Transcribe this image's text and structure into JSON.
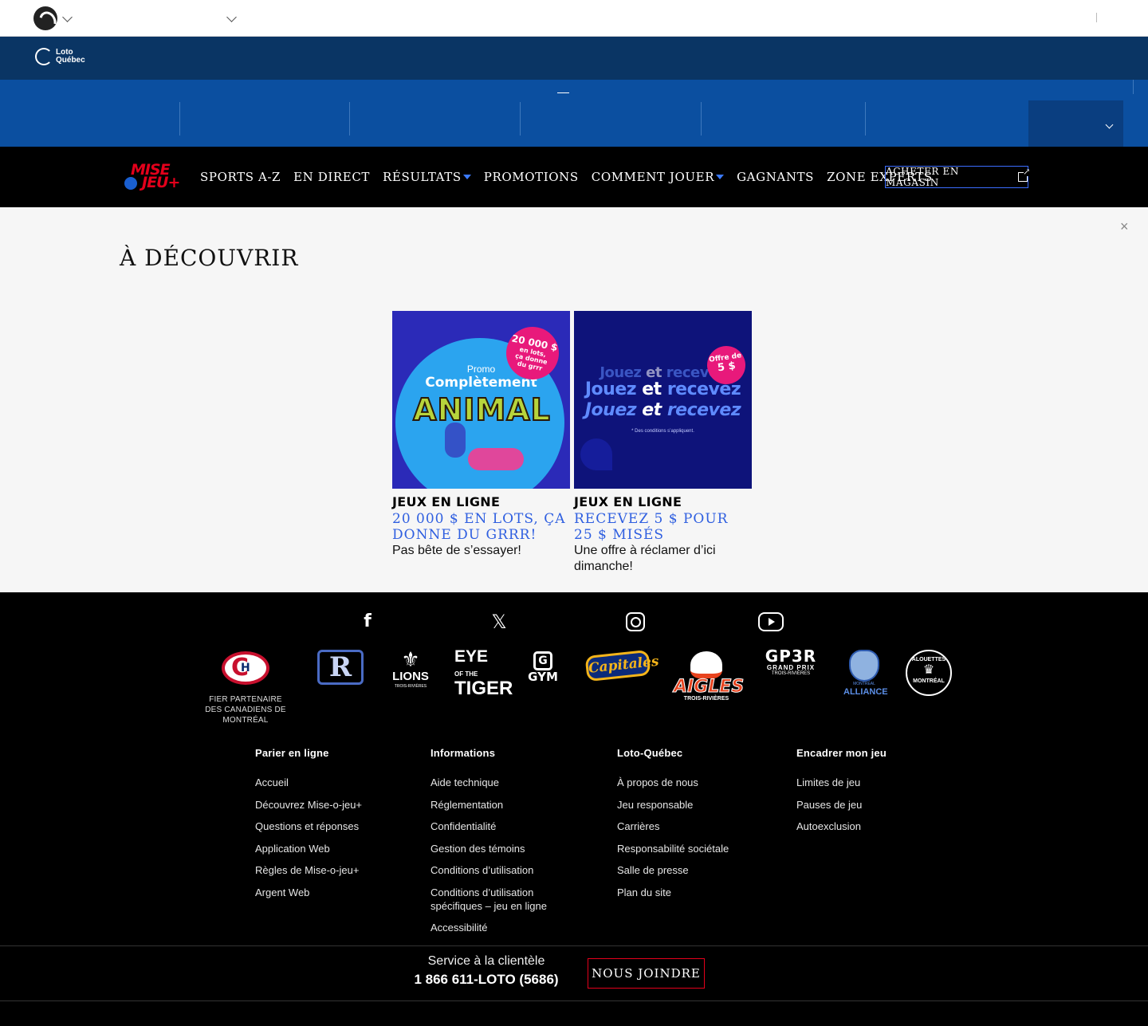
{
  "nav": {
    "brand_top": "MISE",
    "brand_bottom": "JEU+",
    "items": [
      {
        "label": "SPORTS A-Z",
        "dropdown": false
      },
      {
        "label": "EN DIRECT",
        "dropdown": false
      },
      {
        "label": "RÉSULTATS",
        "dropdown": true
      },
      {
        "label": "PROMOTIONS",
        "dropdown": false
      },
      {
        "label": "COMMENT JOUER",
        "dropdown": true
      },
      {
        "label": "GAGNANTS",
        "dropdown": false
      },
      {
        "label": "ZONE EXPERTS",
        "dropdown": false
      }
    ],
    "buy_label": "ACHETER EN MAGASIN"
  },
  "header": {
    "lq_line1": "Loto",
    "lq_line2": "Québec"
  },
  "discover": {
    "title": "À DÉCOUVRIR",
    "close": "×",
    "cards": [
      {
        "category": "JEUX EN LIGNE",
        "title": "20 000 $ en lots, ça donne du grrr!",
        "description": "Pas bête de s’essayer!",
        "image": {
          "badge_line1": "20 000 $",
          "badge_line2": "en lots,",
          "badge_line3": "ça donne",
          "badge_line4": "du grrr",
          "promo": "Promo",
          "headline": "Complètement",
          "big": "ANIMAL"
        }
      },
      {
        "category": "JEUX EN LIGNE",
        "title": "Recevez 5 $ pour 25 $ misés",
        "description": "Une offre à réclamer d’ici dimanche!",
        "image": {
          "word_a": "Jouez",
          "word_b": "et",
          "word_c": "recevez",
          "badge_line1": "Offre de",
          "badge_line2": "5 $",
          "fine": "* Des conditions s’appliquent."
        }
      }
    ]
  },
  "footer": {
    "social": [
      "facebook-icon",
      "x-icon",
      "instagram-icon",
      "youtube-icon"
    ],
    "partners": {
      "cdn_line1": "FIER PARTENAIRE",
      "cdn_line2": "DES CANADIENS DE MONTRÉAL",
      "rocket": "R",
      "lions": "LIONS",
      "lions_sub": "TROIS-RIVIÈRES",
      "eye1": "EYE",
      "eye2": "OF THE",
      "eye3": "TIGER",
      "gym_mark": "G",
      "gym": "GYM",
      "capitales": "Capitales",
      "aigles": "AIGLES",
      "aigles_sub": "TROIS-RIVIÈRES",
      "gp3r": "GP3R",
      "gp3r_sub1": "GRAND PRIX",
      "gp3r_sub2": "TROIS-RIVIÈRES",
      "alliance1": "MONTRÉAL",
      "alliance2": "ALLIANCE",
      "alouettes1": "ALOUETTES",
      "alouettes2": "MONTRÉAL"
    },
    "columns": [
      {
        "title": "Parier en ligne",
        "links": [
          "Accueil",
          "Découvrez Mise-o-jeu+",
          "Questions et réponses",
          "Application Web",
          "Règles de Mise-o-jeu+",
          "Argent Web"
        ]
      },
      {
        "title": "Informations",
        "links": [
          "Aide technique",
          "Réglementation",
          "Confidentialité",
          "Gestion des témoins",
          "Conditions d’utilisation",
          "Conditions d’utilisation spécifiques – jeu en ligne",
          "Accessibilité"
        ]
      },
      {
        "title": "Loto-Québec",
        "links": [
          "À propos de nous",
          "Jeu responsable",
          "Carrières",
          "Responsabilité sociétale",
          "Salle de presse",
          "Plan du site"
        ]
      },
      {
        "title": "Encadrer mon jeu",
        "links": [
          "Limites de jeu",
          "Pauses de jeu",
          "Autoexclusion"
        ]
      }
    ],
    "service_label": "Service à la clientèle",
    "service_phone": "1 866 611-LOTO (5686)",
    "contact_button": "NOUS JOINDRE"
  },
  "colors": {
    "navy": "#0a3564",
    "blue": "#0b4fa0",
    "accent_blue": "#2f5fe0",
    "brand_red": "#e3001b",
    "pink": "#e8197b"
  }
}
